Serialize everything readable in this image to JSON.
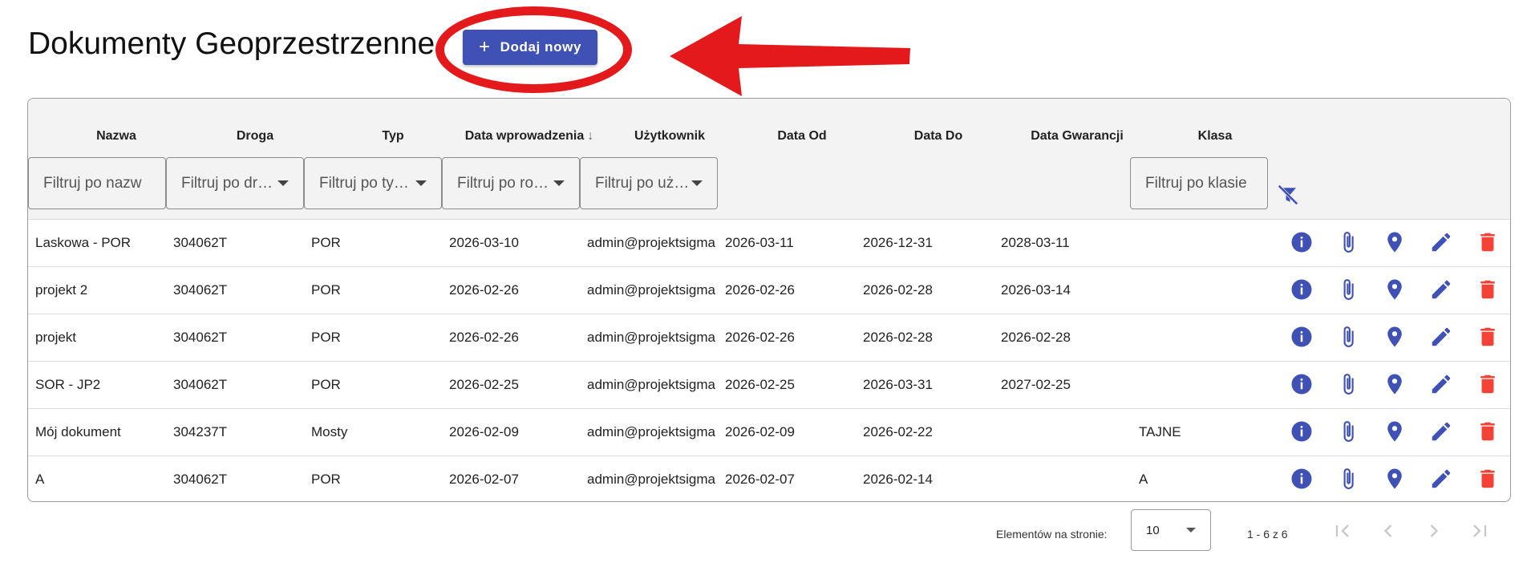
{
  "page": {
    "title": "Dokumenty Geoprzestrzenne"
  },
  "toolbar": {
    "add_label": "Dodaj nowy",
    "add_icon": "plus-icon"
  },
  "table": {
    "columns": [
      "Nazwa",
      "Droga",
      "Typ",
      "Data wprowadzenia",
      "Użytkownik",
      "Data Od",
      "Data Do",
      "Data Gwarancji",
      "Klasa"
    ],
    "sort": {
      "column": "Data wprowadzenia",
      "direction": "desc"
    },
    "filters": {
      "nazwa": "Filtruj po nazw",
      "droga": "Filtruj po dr…",
      "typ": "Filtruj po ty…",
      "data": "Filtruj po ro…",
      "uzytkownik": "Filtruj po uż…",
      "klasa": "Filtruj po klasie"
    },
    "rows": [
      [
        "Laskowa - POR",
        "304062T",
        "POR",
        "2026-03-10",
        "admin@projektsigma",
        "2026-03-11",
        "2026-12-31",
        "2028-03-11",
        ""
      ],
      [
        "projekt 2",
        "304062T",
        "POR",
        "2026-02-26",
        "admin@projektsigma",
        "2026-02-26",
        "2026-02-28",
        "2026-03-14",
        ""
      ],
      [
        "projekt",
        "304062T",
        "POR",
        "2026-02-26",
        "admin@projektsigma",
        "2026-02-26",
        "2026-02-28",
        "2026-02-28",
        ""
      ],
      [
        "SOR - JP2",
        "304062T",
        "POR",
        "2026-02-25",
        "admin@projektsigma",
        "2026-02-25",
        "2026-03-31",
        "2027-02-25",
        ""
      ],
      [
        "Mój dokument",
        "304237T",
        "Mosty",
        "2026-02-09",
        "admin@projektsigma",
        "2026-02-09",
        "2026-02-22",
        "",
        "TAJNE"
      ],
      [
        "A",
        "304062T",
        "POR",
        "2026-02-07",
        "admin@projektsigma",
        "2026-02-07",
        "2026-02-14",
        "",
        "A"
      ]
    ],
    "row_actions": [
      "info-icon",
      "attachment-icon",
      "location-pin-icon",
      "edit-icon",
      "delete-icon"
    ]
  },
  "paginator": {
    "label": "Elementów na stronie:",
    "page_size": "10",
    "range": "1 - 6 z 6"
  },
  "colors": {
    "accent": "#3f51b5",
    "delete": "#f44336",
    "annotation": "#e3191c",
    "header_bg": "#f3f3f3"
  }
}
